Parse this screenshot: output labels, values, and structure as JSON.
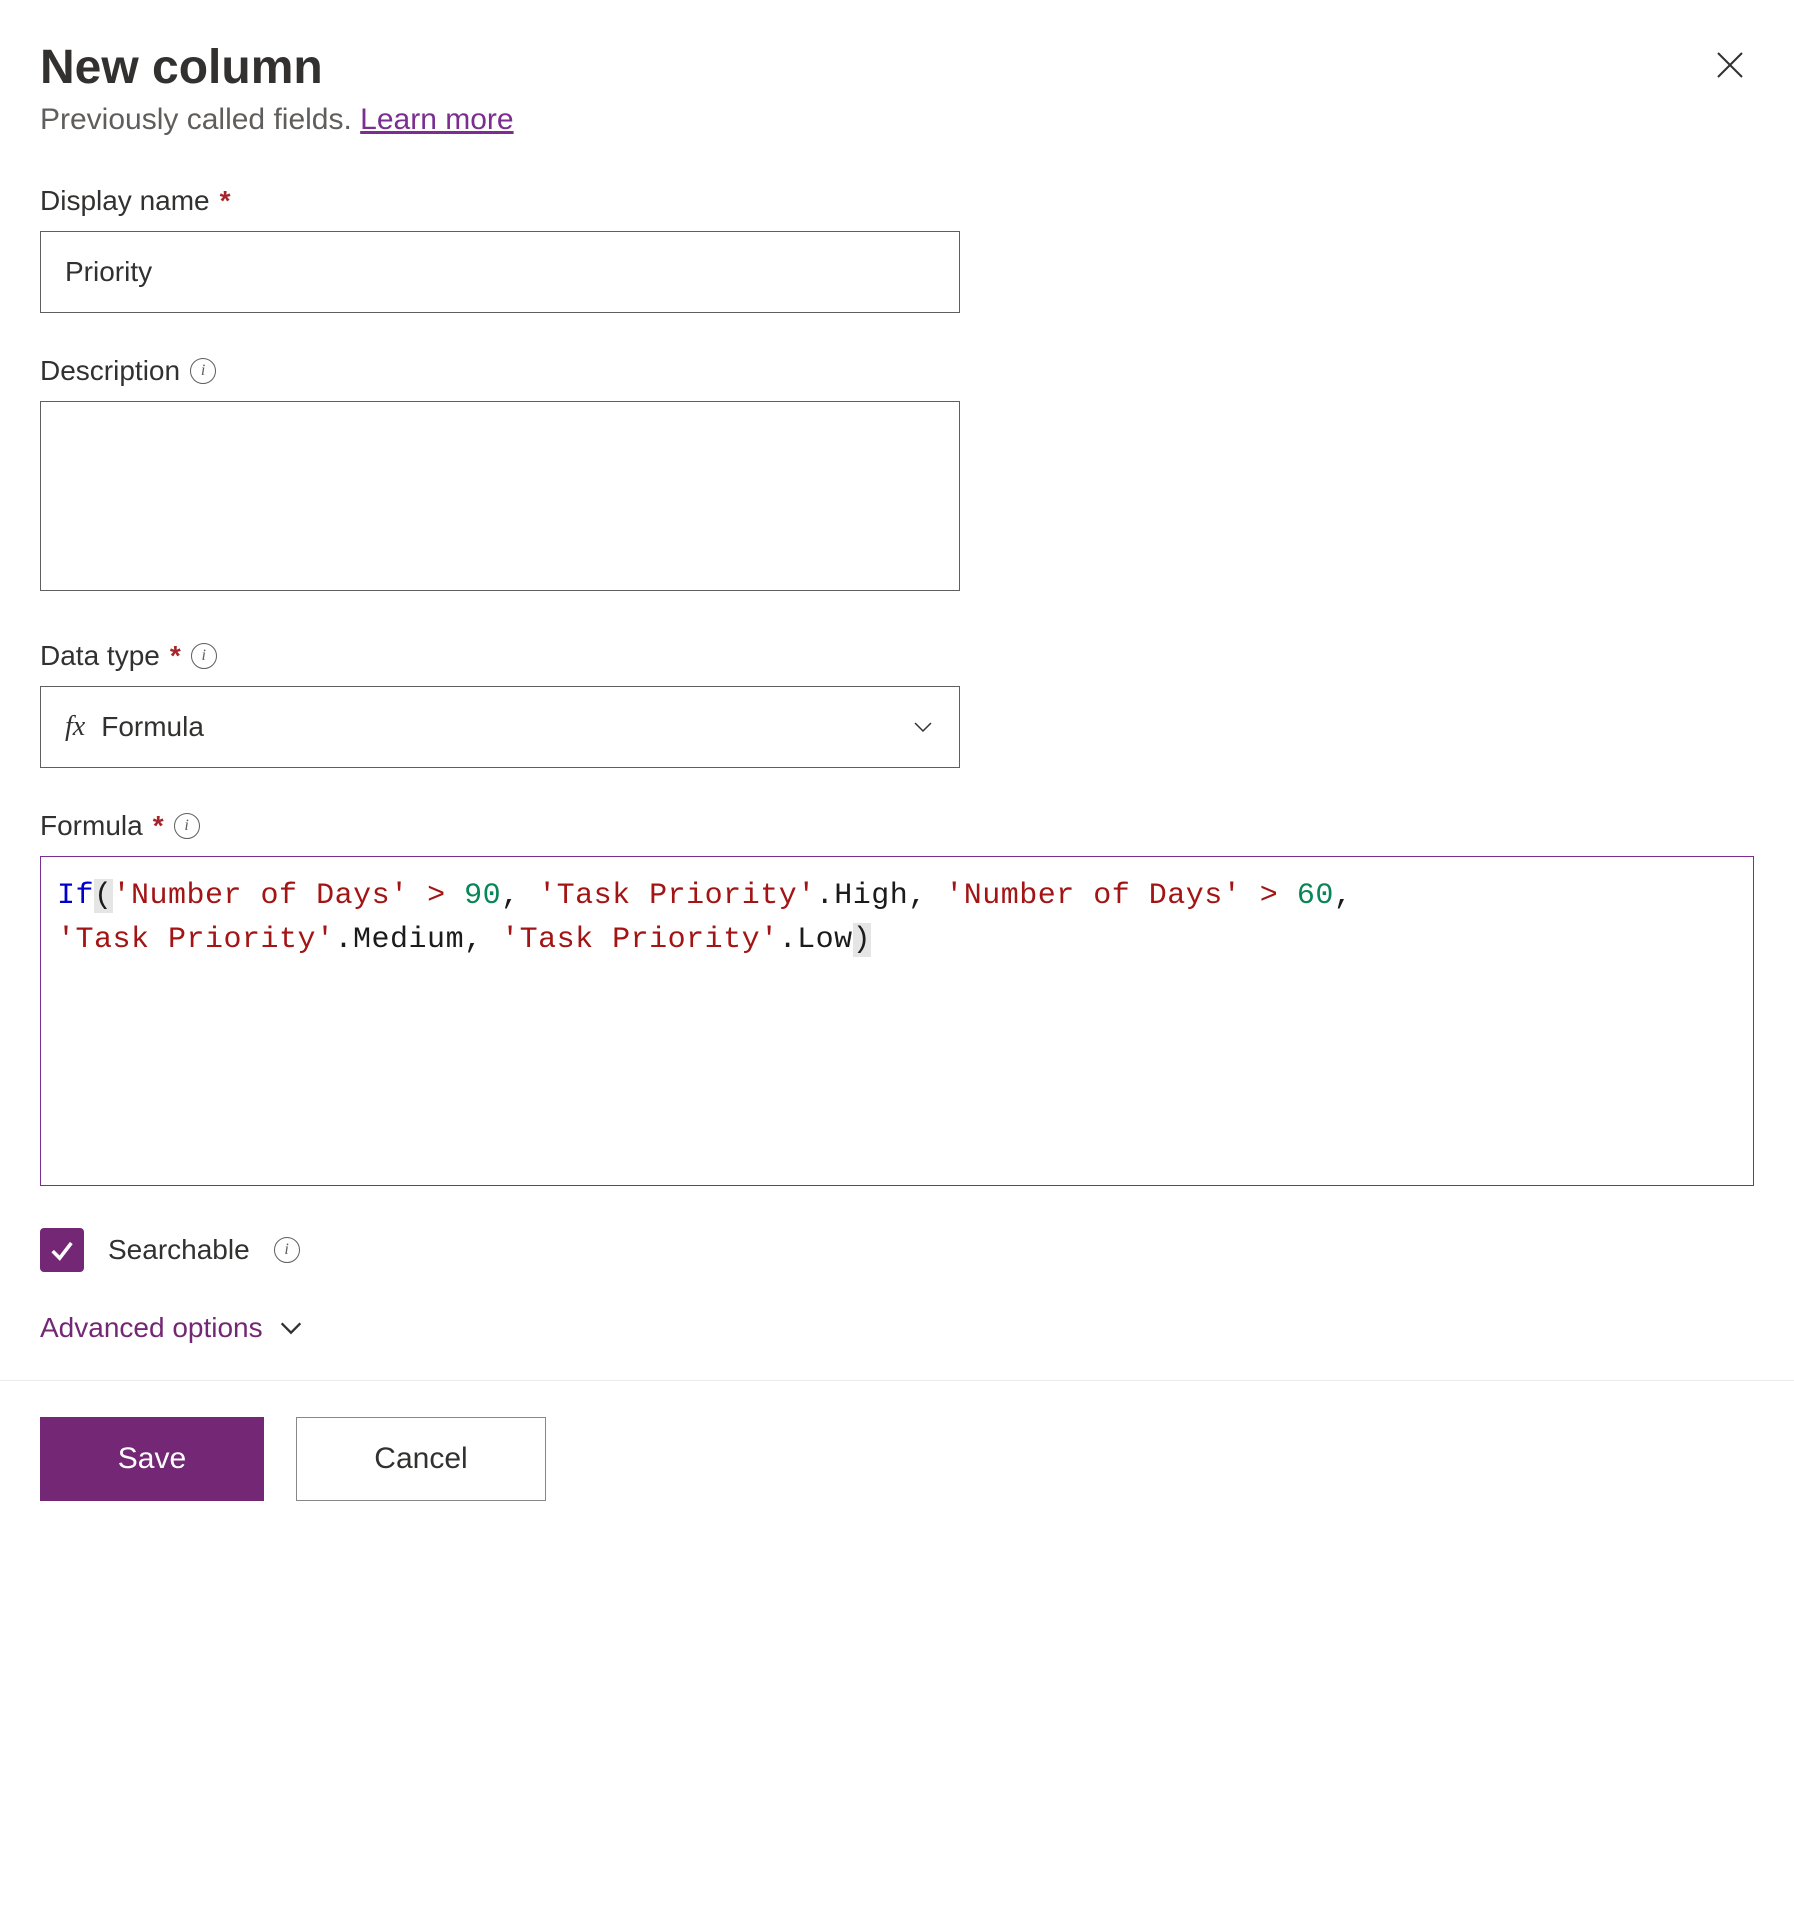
{
  "panel": {
    "title": "New column",
    "subtitle_text": "Previously called fields. ",
    "learn_more": "Learn more"
  },
  "fields": {
    "display_name": {
      "label": "Display name",
      "value": "Priority"
    },
    "description": {
      "label": "Description",
      "value": ""
    },
    "data_type": {
      "label": "Data type",
      "value": "Formula"
    },
    "formula": {
      "label": "Formula",
      "tokens": {
        "if": "If",
        "lp1": "(",
        "str1": "'Number of Days'",
        "sp1": " ",
        "op1": ">",
        "sp2": " ",
        "num1": "90",
        "c1": ", ",
        "str2": "'Task Priority'",
        "p1": ".High, ",
        "str3": "'Number of Days'",
        "sp3": " ",
        "op2": ">",
        "sp4": " ",
        "num2": "60",
        "c2": ",",
        "str4": "'Task Priority'",
        "p2": ".Medium, ",
        "str5": "'Task Priority'",
        "p3": ".Low",
        "rp1": ")"
      }
    },
    "searchable": {
      "label": "Searchable",
      "checked": true
    }
  },
  "advanced_options": "Advanced options",
  "buttons": {
    "save": "Save",
    "cancel": "Cancel"
  }
}
